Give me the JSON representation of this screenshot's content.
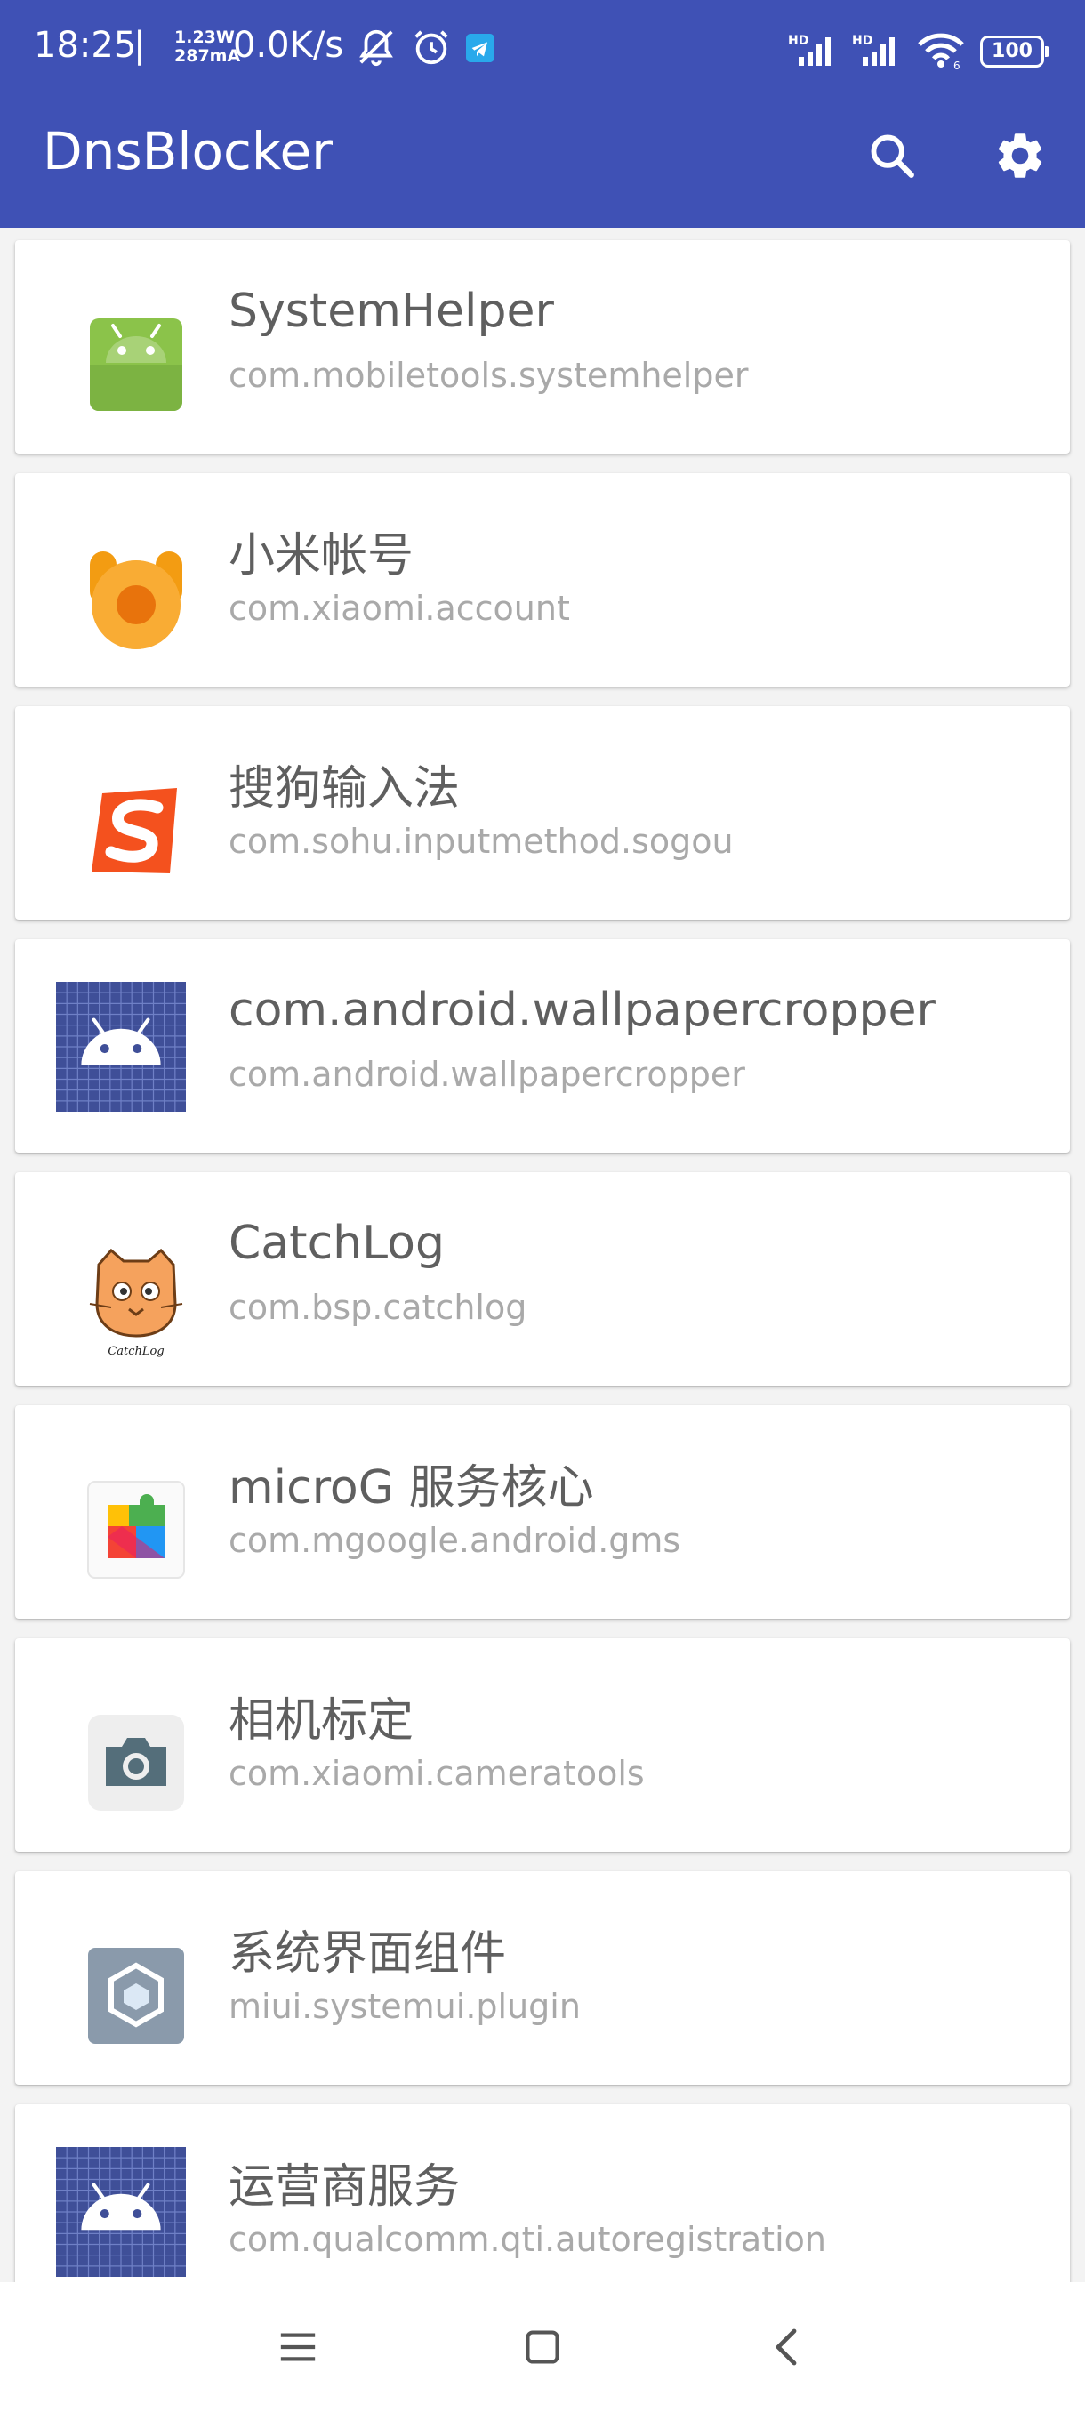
{
  "status_bar": {
    "time": "18:25",
    "separator": "|",
    "rate_top": "1.23W",
    "rate_bottom": "287mA",
    "speed": "0.0K/s",
    "battery": "100",
    "icons": [
      "mute-alarm-icon",
      "alarm-clock-icon",
      "telegram-icon",
      "hd-signal-icon",
      "hd-signal-icon",
      "wifi-icon",
      "battery-icon"
    ]
  },
  "app_bar": {
    "title": "DnsBlocker",
    "actions": [
      "search-icon",
      "settings-gear-icon"
    ]
  },
  "apps": [
    {
      "name": "SystemHelper",
      "package": "com.mobiletools.systemhelper",
      "icon": "android-green-icon"
    },
    {
      "name": "小米帐号",
      "package": "com.xiaomi.account",
      "icon": "xiaomi-account-icon"
    },
    {
      "name": "搜狗输入法",
      "package": "com.sohu.inputmethod.sogou",
      "icon": "sogou-icon"
    },
    {
      "name": "com.android.wallpapercropper",
      "package": "com.android.wallpapercropper",
      "icon": "android-default-grid-icon"
    },
    {
      "name": "CatchLog",
      "package": "com.bsp.catchlog",
      "icon": "catchlog-cat-icon",
      "icon_caption": "CatchLog"
    },
    {
      "name": "microG 服务核心",
      "package": "com.mgoogle.android.gms",
      "icon": "microg-puzzle-icon"
    },
    {
      "name": "相机标定",
      "package": "com.xiaomi.cameratools",
      "icon": "camera-icon"
    },
    {
      "name": "系统界面组件",
      "package": "miui.systemui.plugin",
      "icon": "systemui-plugin-icon"
    },
    {
      "name": "运营商服务",
      "package": "com.qualcomm.qti.autoregistration",
      "icon": "android-default-grid-icon"
    }
  ],
  "nav_bar": {
    "buttons": [
      "menu-icon",
      "home-square-icon",
      "back-chevron-icon"
    ]
  },
  "colors": {
    "primary": "#3f51b5",
    "background": "#f3f3f3",
    "title_text": "#5f5f5f",
    "package_text": "#a9a9a9"
  }
}
